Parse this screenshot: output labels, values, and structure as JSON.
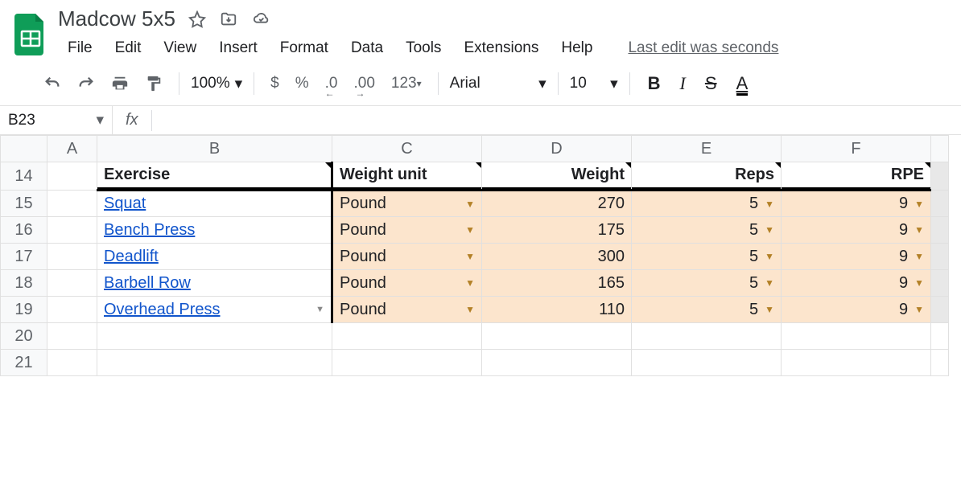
{
  "doc": {
    "title": "Madcow 5x5"
  },
  "menu": {
    "file": "File",
    "edit": "Edit",
    "view": "View",
    "insert": "Insert",
    "format": "Format",
    "data": "Data",
    "tools": "Tools",
    "extensions": "Extensions",
    "help": "Help",
    "last_edit": "Last edit was seconds"
  },
  "toolbar": {
    "zoom": "100%",
    "currency": "$",
    "percent": "%",
    "dec_dec": ".0",
    "inc_dec": ".00",
    "more_fmt": "123",
    "font": "Arial",
    "font_size": "10",
    "bold": "B",
    "italic": "I",
    "strike": "S",
    "text_color": "A"
  },
  "namebox": {
    "cell_ref": "B23",
    "fx": "fx",
    "formula_value": ""
  },
  "columns": {
    "A": "A",
    "B": "B",
    "C": "C",
    "D": "D",
    "E": "E",
    "F": "F"
  },
  "row_nums": [
    "14",
    "15",
    "16",
    "17",
    "18",
    "19",
    "20",
    "21"
  ],
  "headers": {
    "exercise": "Exercise",
    "weight_unit": "Weight unit",
    "weight": "Weight",
    "reps": "Reps",
    "rpe": "RPE"
  },
  "rows": [
    {
      "exercise": "Squat",
      "unit": "Pound",
      "weight": "270",
      "reps": "5",
      "rpe": "9"
    },
    {
      "exercise": "Bench Press",
      "unit": "Pound",
      "weight": "175",
      "reps": "5",
      "rpe": "9"
    },
    {
      "exercise": "Deadlift",
      "unit": "Pound",
      "weight": "300",
      "reps": "5",
      "rpe": "9"
    },
    {
      "exercise": "Barbell Row",
      "unit": "Pound",
      "weight": "165",
      "reps": "5",
      "rpe": "9"
    },
    {
      "exercise": "Overhead Press",
      "unit": "Pound",
      "weight": "110",
      "reps": "5",
      "rpe": "9"
    }
  ]
}
